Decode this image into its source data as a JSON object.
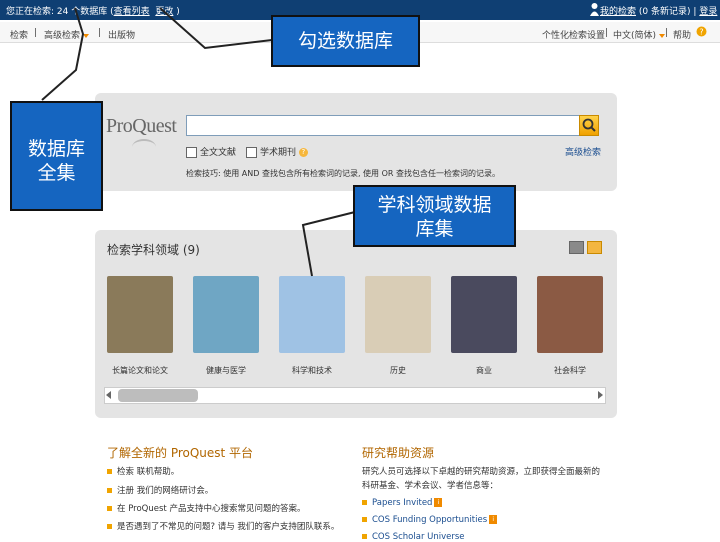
{
  "topbar": {
    "status": "您正在检索: 24 个数据库 (",
    "view_list": "查看列表",
    "change": "更改",
    "suffix": ")",
    "my_search": "我的检索",
    "records": "(0 条新记录)",
    "separator": "|",
    "login": "登录"
  },
  "nav": {
    "basic_search": "检索",
    "advanced_search": "高级检索",
    "publications": "出版物",
    "personalize": "个性化检索设置",
    "language": "中文(简体)",
    "help": "帮助",
    "separator": "|"
  },
  "search": {
    "logo": "ProQuest",
    "fulltext_label": "全文文献",
    "peer_reviewed_label": "学术期刊",
    "advanced_link": "高级检索",
    "tips": "检索技巧: 使用 AND 查找包含所有检索词的记录, 使用 OR 查找包含任一检索词的记录。",
    "query": ""
  },
  "subjects": {
    "title": "检索学科领域 (9)",
    "items": [
      {
        "label": "长篇论文和论文",
        "color": "#8a7a5a"
      },
      {
        "label": "健康与医学",
        "color": "#6fa6c4"
      },
      {
        "label": "科学和技术",
        "color": "#9fc2e4"
      },
      {
        "label": "历史",
        "color": "#d9cdb6"
      },
      {
        "label": "商业",
        "color": "#4a4a5e"
      },
      {
        "label": "社会科学",
        "color": "#8b5a44"
      }
    ]
  },
  "bottom_left": {
    "heading": "了解全新的 ProQuest 平台",
    "lines": [
      "检索 联机帮助。",
      "注册 我们的网络研讨会。",
      "在 ProQuest 产品支持中心搜索常见问题的答案。",
      "是否遇到了不常见的问题? 请与 我们的客户支持团队联系。"
    ]
  },
  "bottom_right": {
    "heading": "研究帮助资源",
    "intro_1": "研究人员可选择以下卓越的研究帮助资源，立即获得全面最新的",
    "intro_2": "科研基金、学术会议、学者信息等：",
    "links": [
      "Papers Invited",
      "COS Funding Opportunities",
      "COS Scholar Universe"
    ]
  },
  "callouts": {
    "select_db": "勾选数据库",
    "all_db_1": "数据库",
    "all_db_2": "全集",
    "subject_db_1": "学科领域数据",
    "subject_db_2": "库集"
  },
  "colors": {
    "topbar": "#0f3f73",
    "callout": "#1565c0",
    "heading": "#b16600",
    "accent": "#f0a400"
  }
}
